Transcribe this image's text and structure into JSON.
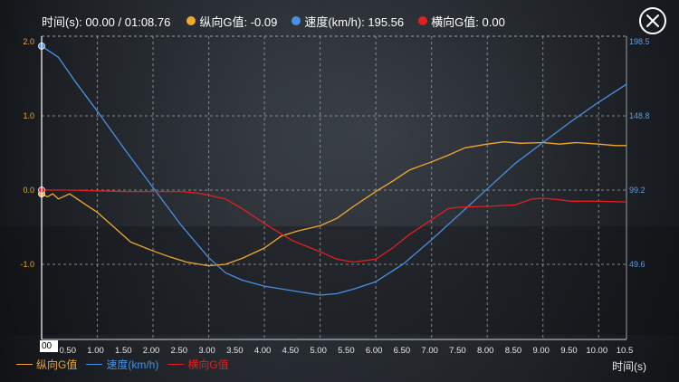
{
  "header": {
    "time_label": "时间(s): 00.00 / 01:08.76",
    "series": [
      {
        "label": "纵向G值: -0.09",
        "color": "#f0a830"
      },
      {
        "label": "速度(km/h): 195.56",
        "color": "#4a90e2"
      },
      {
        "label": "横向G值: 0.00",
        "color": "#e02020"
      }
    ],
    "close_icon": "close-icon"
  },
  "chart_data": {
    "type": "line",
    "xlabel": "时间(s)",
    "x_ticks": [
      "00",
      "0.50",
      "1.00",
      "1.50",
      "2.00",
      "2.50",
      "3.00",
      "3.50",
      "4.00",
      "4.50",
      "5.00",
      "5.50",
      "6.00",
      "6.50",
      "7.00",
      "7.50",
      "8.00",
      "8.50",
      "9.00",
      "9.50",
      "10.00",
      "10.5"
    ],
    "xlim": [
      0,
      10.5
    ],
    "y_left_ticks": [
      "2.0",
      "1.0",
      "0.0",
      "-1.0"
    ],
    "y_left_lim": [
      -2.0,
      2.0
    ],
    "y_right_ticks": [
      "198.5",
      "148.8",
      "99.2",
      "49.6"
    ],
    "y_right_lim": [
      0,
      198.5
    ],
    "series": [
      {
        "name": "纵向G值",
        "color": "#f0a830",
        "axis": "left",
        "x": [
          0,
          0.1,
          0.2,
          0.3,
          0.5,
          0.8,
          1.0,
          1.3,
          1.6,
          2.0,
          2.3,
          2.6,
          3.0,
          3.3,
          3.6,
          4.0,
          4.3,
          4.6,
          5.0,
          5.3,
          5.6,
          6.0,
          6.3,
          6.6,
          7.0,
          7.3,
          7.6,
          8.0,
          8.3,
          8.6,
          9.0,
          9.3,
          9.6,
          10.0,
          10.3,
          10.5
        ],
        "y": [
          -0.05,
          -0.09,
          -0.05,
          -0.12,
          -0.05,
          -0.2,
          -0.3,
          -0.5,
          -0.7,
          -0.82,
          -0.9,
          -0.97,
          -1.02,
          -1.0,
          -0.92,
          -0.78,
          -0.62,
          -0.55,
          -0.48,
          -0.38,
          -0.22,
          -0.02,
          0.12,
          0.27,
          0.38,
          0.47,
          0.57,
          0.62,
          0.65,
          0.63,
          0.64,
          0.62,
          0.64,
          0.62,
          0.6,
          0.6
        ]
      },
      {
        "name": "速度(km/h)",
        "color": "#4a90e2",
        "axis": "right",
        "x": [
          0,
          0.3,
          0.6,
          1.0,
          1.5,
          2.0,
          2.5,
          3.0,
          3.3,
          3.6,
          4.0,
          4.5,
          5.0,
          5.3,
          5.6,
          6.0,
          6.5,
          7.0,
          7.5,
          8.0,
          8.5,
          9.0,
          9.5,
          10.0,
          10.5
        ],
        "y": [
          195.56,
          188,
          172,
          152,
          126,
          101,
          76,
          54,
          44,
          39,
          35,
          32,
          29,
          30,
          33,
          38,
          50,
          66,
          83,
          100,
          117,
          131,
          145,
          158,
          170
        ]
      },
      {
        "name": "横向G值",
        "color": "#e02020",
        "axis": "left",
        "x": [
          0,
          0.5,
          1.0,
          1.5,
          2.0,
          2.5,
          2.8,
          3.0,
          3.3,
          3.6,
          4.0,
          4.5,
          5.0,
          5.3,
          5.6,
          6.0,
          6.3,
          6.6,
          7.0,
          7.3,
          7.5,
          8.0,
          8.5,
          8.8,
          9.0,
          9.3,
          9.5,
          10.0,
          10.5
        ],
        "y": [
          0.0,
          0.0,
          -0.01,
          -0.02,
          -0.02,
          -0.02,
          -0.04,
          -0.07,
          -0.12,
          -0.25,
          -0.45,
          -0.68,
          -0.83,
          -0.93,
          -0.97,
          -0.93,
          -0.78,
          -0.6,
          -0.4,
          -0.25,
          -0.23,
          -0.22,
          -0.2,
          -0.12,
          -0.11,
          -0.13,
          -0.15,
          -0.15,
          -0.16
        ]
      }
    ],
    "grid": true
  },
  "bottom_legend": [
    {
      "label": "纵向G值",
      "color": "#f0a830"
    },
    {
      "label": "速度(km/h)",
      "color": "#4a90e2"
    },
    {
      "label": "横向G值",
      "color": "#e02020"
    }
  ],
  "x_start_label": "00"
}
